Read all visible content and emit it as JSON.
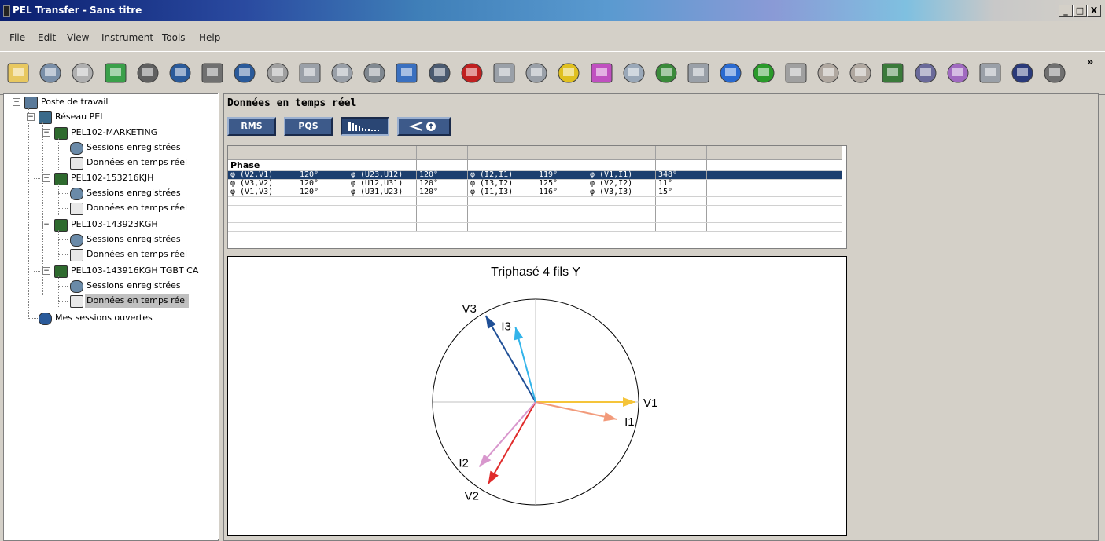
{
  "window": {
    "title": "PEL Transfer - Sans titre",
    "controls": [
      "_",
      "□",
      "X"
    ]
  },
  "menu": [
    "File",
    "Edit",
    "View",
    "Instrument",
    "Tools",
    "Help"
  ],
  "toolbar": {
    "icons": [
      "open-folder-icon",
      "save-icon",
      "document-icon",
      "download-icon",
      "print-icon",
      "network-icon",
      "print-preview-icon",
      "disconnect-icon",
      "report-icon",
      "zoom-in-icon",
      "zoom-out-icon",
      "instrument-add-icon",
      "sync-icon",
      "tools-icon",
      "record-icon",
      "search-icon",
      "search-remove-icon",
      "traffic-light-icon",
      "pie-chart-icon",
      "navigate-icon",
      "chart-icon",
      "measure-icon",
      "refresh-icon",
      "arrow-left-icon",
      "arrow-right-icon",
      "folder-new-icon",
      "folder-open-icon",
      "export-icon",
      "edit-icon",
      "email-icon",
      "sign-icon",
      "settings-wrench-icon",
      "gear-icon"
    ],
    "overflow": "»"
  },
  "tree": {
    "root": "Poste de travail",
    "network": "Réseau PEL",
    "instruments": [
      {
        "name": "PEL102-MARKETING",
        "children": [
          "Sessions enregistrées",
          "Données en temps réel"
        ]
      },
      {
        "name": "PEL102-153216KJH",
        "children": [
          "Sessions enregistrées",
          "Données en temps réel"
        ]
      },
      {
        "name": "PEL103-143923KGH",
        "children": [
          "Sessions enregistrées",
          "Données en temps réel"
        ]
      },
      {
        "name": "PEL103-143916KGH TGBT CA",
        "children": [
          "Sessions enregistrées",
          "Données en temps réel"
        ]
      }
    ],
    "open_sessions": "Mes sessions ouvertes"
  },
  "main": {
    "heading": "Données en temps réel",
    "mode_buttons": [
      "RMS",
      "PQS",
      "Illıııııı",
      "∢⏲"
    ],
    "table": {
      "section_label": "Phase",
      "rows": [
        [
          "φ (V2,V1)",
          "120°",
          "φ (U23,U12)",
          "120°",
          "φ (I2,I1)",
          "119°",
          "φ (V1,I1)",
          "348°"
        ],
        [
          "φ (V3,V2)",
          "120°",
          "φ (U12,U31)",
          "120°",
          "φ (I3,I2)",
          "125°",
          "φ (V2,I2)",
          "11°"
        ],
        [
          "φ (V1,V3)",
          "120°",
          "φ (U31,U23)",
          "120°",
          "φ (I1,I3)",
          "116°",
          "φ (V3,I3)",
          "15°"
        ]
      ]
    },
    "diagram": {
      "title": "Triphasé 4 fils Y",
      "vectors": [
        {
          "label": "V1",
          "angle_deg": 0,
          "magnitude": 1.0,
          "color": "#f5c43a"
        },
        {
          "label": "I1",
          "angle_deg": -12,
          "magnitude": 0.83,
          "color": "#f29a7a"
        },
        {
          "label": "V2",
          "angle_deg": -120,
          "magnitude": 0.95,
          "color": "#e02b2b"
        },
        {
          "label": "I2",
          "angle_deg": -131,
          "magnitude": 0.86,
          "color": "#d897cd"
        },
        {
          "label": "V3",
          "angle_deg": 120,
          "magnitude": 1.0,
          "color": "#1f4f96"
        },
        {
          "label": "I3",
          "angle_deg": 105,
          "magnitude": 0.78,
          "color": "#33b4ea"
        }
      ]
    }
  }
}
